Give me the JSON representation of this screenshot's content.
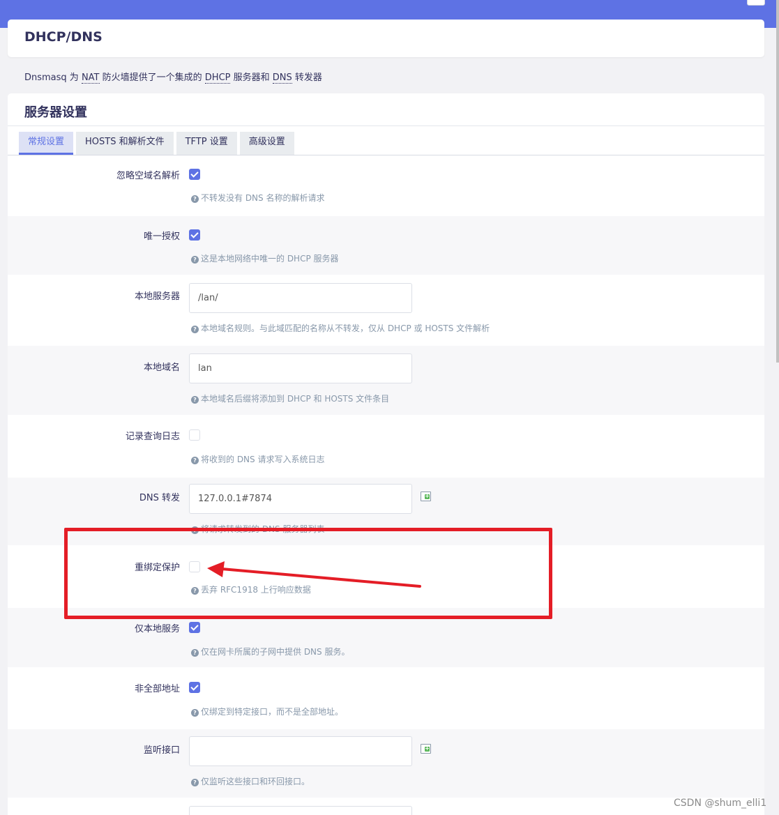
{
  "page": {
    "title": "DHCP/DNS",
    "description_parts": [
      "Dnsmasq 为 ",
      "NAT",
      " 防火墙提供了一个集成的 ",
      "DHCP",
      " 服务器和 ",
      "DNS",
      " 转发器"
    ]
  },
  "section": {
    "title": "服务器设置",
    "tabs": [
      {
        "label": "常规设置",
        "active": true
      },
      {
        "label": "HOSTS 和解析文件",
        "active": false
      },
      {
        "label": "TFTP 设置",
        "active": false
      },
      {
        "label": "高级设置",
        "active": false
      }
    ]
  },
  "fields": {
    "domainneeded": {
      "label": "忽略空域名解析",
      "checked": true,
      "help": "不转发没有 DNS 名称的解析请求"
    },
    "authoritative": {
      "label": "唯一授权",
      "checked": true,
      "help": "这是本地网络中唯一的 DHCP 服务器"
    },
    "local": {
      "label": "本地服务器",
      "value": "/lan/",
      "help": "本地域名规则。与此域匹配的名称从不转发，仅从 DHCP 或 HOSTS 文件解析"
    },
    "domain": {
      "label": "本地域名",
      "value": "lan",
      "help": "本地域名后缀将添加到 DHCP 和 HOSTS 文件条目"
    },
    "logqueries": {
      "label": "记录查询日志",
      "checked": false,
      "help": "将收到的 DNS 请求写入系统日志"
    },
    "server": {
      "label": "DNS 转发",
      "value": "127.0.0.1#7874",
      "help": "将请求转发到的 DNS 服务器列表"
    },
    "rebind_protection": {
      "label": "重绑定保护",
      "checked": false,
      "help": "丢弃 RFC1918 上行响应数据"
    },
    "localservice": {
      "label": "仅本地服务",
      "checked": true,
      "help": "仅在网卡所属的子网中提供 DNS 服务。"
    },
    "nonwildcard": {
      "label": "非全部地址",
      "checked": true,
      "help": "仅绑定到特定接口，而不是全部地址。"
    },
    "interface": {
      "label": "监听接口",
      "value": "",
      "help": "仅监听这些接口和环回接口。"
    }
  },
  "help_icon_glyph": "?",
  "watermark": "CSDN @shum_elli1",
  "colors": {
    "accent": "#5e72e4",
    "annotation_red": "#e41d26"
  }
}
